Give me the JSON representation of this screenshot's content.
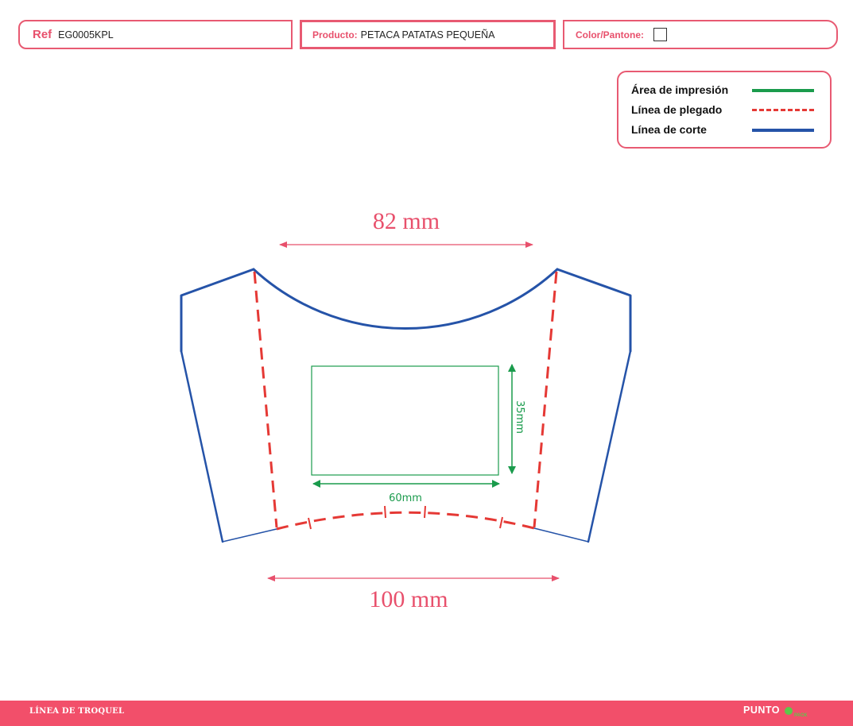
{
  "header": {
    "ref": {
      "label": "Ref",
      "value": "EG0005KPL"
    },
    "product": {
      "label": "Producto:",
      "value": "PETACA PATATAS PEQUEÑA"
    },
    "color": {
      "label": "Color/Pantone:"
    }
  },
  "legend": {
    "items": [
      {
        "label": "Área de impresión",
        "color": "#1a9b4c",
        "style": "solid"
      },
      {
        "label": "Línea de plegado",
        "color": "#e53935",
        "style": "dashed"
      },
      {
        "label": "Línea de corte",
        "color": "#2553a8",
        "style": "solid"
      }
    ]
  },
  "dimensions": {
    "top_width": "82 mm",
    "bottom_width": "100 mm",
    "print_width": "60mm",
    "print_height": "35mm"
  },
  "colors": {
    "accent": "#e85a72",
    "cut": "#2553a8",
    "fold": "#e53935",
    "print": "#1a9b4c",
    "dimension": "#e8506c"
  },
  "footer": {
    "title": "LÍNEA DE TROQUEL",
    "logo": "PUNTO",
    "logo_sub": "PACK"
  }
}
